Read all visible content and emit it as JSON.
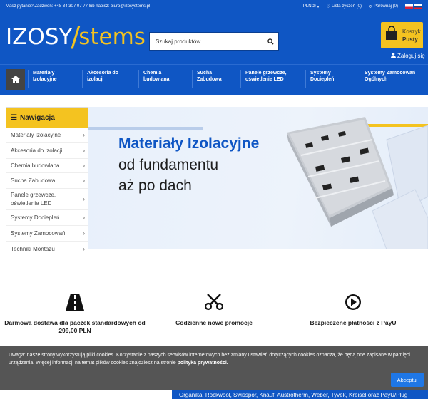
{
  "topbar": {
    "contact_text": "Masz pytanie? Zadzwoń: +48 34 307 07 77 lub napisz: biuro@izosystems.pl",
    "currency": "PLN zł",
    "wishlist": "Lista życzeń (0)",
    "compare": "Porównaj (0)"
  },
  "header": {
    "logo_part1": "IZOSY",
    "logo_slash": "/",
    "logo_part2": "stems",
    "search_placeholder": "Szukaj produktów",
    "cart_title": "Koszyk",
    "cart_status": "Pusty",
    "login_label": "Zaloguj się"
  },
  "nav": {
    "items": [
      {
        "label": "Materiały Izolacyjne"
      },
      {
        "label": "Akcesoria do izolacji"
      },
      {
        "label": "Chemia budowlana"
      },
      {
        "label": "Sucha Zabudowa"
      },
      {
        "label": "Panele grzewcze, oświetlenie LED"
      },
      {
        "label": "Systemy Dociepleń"
      },
      {
        "label": "Systemy Zamocowań Ogólnych"
      }
    ]
  },
  "sidebar": {
    "title": "Nawigacja",
    "items": [
      {
        "label": "Materiały Izolacyjne"
      },
      {
        "label": "Akcesoria do izolacji"
      },
      {
        "label": "Chemia budowlana"
      },
      {
        "label": "Sucha Zabudowa"
      },
      {
        "label": "Panele grzewcze, oświetlenie LED"
      },
      {
        "label": "Systemy Dociepleń"
      },
      {
        "label": "Systemy Zamocowań"
      },
      {
        "label": "Techniki Montażu"
      }
    ]
  },
  "banner": {
    "line1": "Materiały Izolacyjne",
    "line2": "od fundamentu",
    "line3": "aż po dach"
  },
  "features": [
    {
      "label": "Darmowa dostawa dla paczek standardowych od 299,00 PLN",
      "icon": "road-icon"
    },
    {
      "label": "Codzienne nowe promocje",
      "icon": "scissors-icon"
    },
    {
      "label": "Bezpieczene płatności z PayU",
      "icon": "play-circle-icon"
    }
  ],
  "cookie": {
    "message": "Uwaga: nasze strony wykorzystują pliki cookies. Korzystanie z naszych serwisów internetowych bez zmiany ustawień dotyczących cookies oznacza, że będą one zapisane w pamięci urządzenia. Więcej informacji na temat plików cookies znajdziesz na stronie",
    "link": "polityka prywatności.",
    "accept": "Akceptuj"
  },
  "brands_text": "Organika, Rockwool, Swisspor, Knauf, Austrotherm, Weber, Tyvek, Kreisel oraz PayU/Plug",
  "colors": {
    "brand_blue": "#0f56c4",
    "accent_yellow": "#f4c320",
    "home_dark": "#444444",
    "cookie_bg": "#464646",
    "accept_blue": "#1f77e6"
  }
}
